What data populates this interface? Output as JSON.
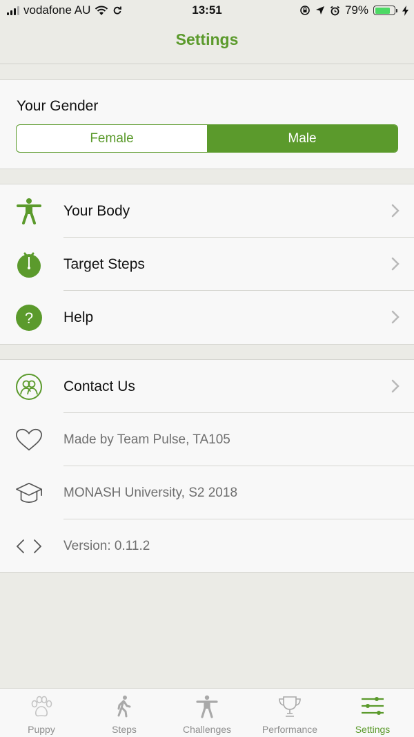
{
  "status_bar": {
    "carrier": "vodafone AU",
    "time": "13:51",
    "battery_percent": "79%",
    "battery_level": 0.79
  },
  "nav": {
    "title": "Settings"
  },
  "gender": {
    "label": "Your Gender",
    "options": [
      "Female",
      "Male"
    ],
    "selected": "Male"
  },
  "menu1": [
    {
      "label": "Your Body",
      "icon": "person-icon"
    },
    {
      "label": "Target Steps",
      "icon": "stopwatch-icon"
    },
    {
      "label": "Help",
      "icon": "help-icon"
    }
  ],
  "menu2": [
    {
      "label": "Contact Us",
      "icon": "contact-icon"
    },
    {
      "label": "Made by Team Pulse, TA105",
      "icon": "heart-icon"
    },
    {
      "label": "MONASH University, S2 2018",
      "icon": "graduation-cap-icon"
    },
    {
      "label": "Version: 0.11.2",
      "icon": "code-icon"
    }
  ],
  "tabs": [
    {
      "label": "Puppy",
      "icon": "paw-icon"
    },
    {
      "label": "Steps",
      "icon": "walking-icon"
    },
    {
      "label": "Challenges",
      "icon": "person-icon"
    },
    {
      "label": "Performance",
      "icon": "trophy-icon"
    },
    {
      "label": "Settings",
      "icon": "sliders-icon"
    }
  ],
  "colors": {
    "accent": "#5b9a2c",
    "background": "#ebebe6",
    "inactive": "#8e8e8e"
  }
}
